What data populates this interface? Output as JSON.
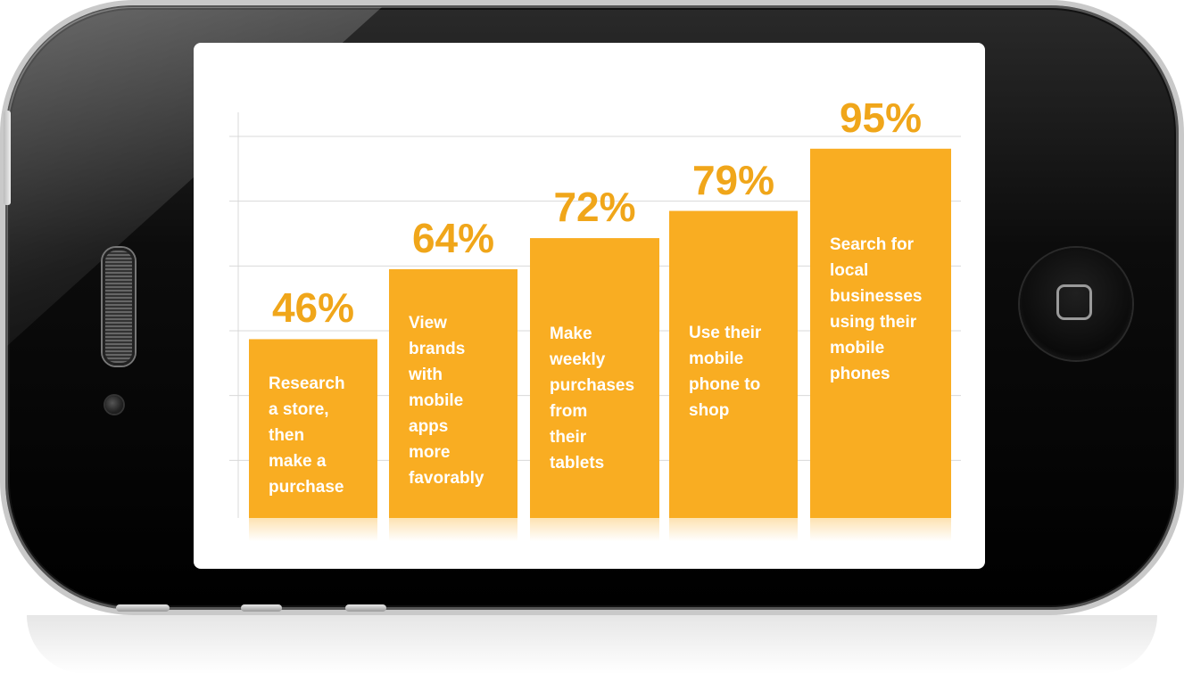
{
  "colors": {
    "bar": "#f9ad22",
    "value_text": "#f0a61a",
    "bar_text": "#ffffff",
    "grid": "#d9d9d9"
  },
  "chart_data": {
    "type": "bar",
    "title": "",
    "xlabel": "",
    "ylabel": "",
    "ylim": [
      0,
      100
    ],
    "grid": true,
    "categories": [
      "Research a store, then make a purchase",
      "View brands with mobile apps more favorably",
      "Make weekly purchases from their tablets",
      "Use their mobile phone to shop",
      "Search for local businesses using their mobile phones"
    ],
    "values": [
      46,
      64,
      72,
      79,
      95
    ],
    "bars": [
      {
        "value_label": "46%",
        "lines": [
          "Research",
          "a store,",
          "then",
          "make a",
          "purchase"
        ]
      },
      {
        "value_label": "64%",
        "lines": [
          "View",
          "brands",
          "with",
          "mobile",
          "apps",
          "more",
          "favorably"
        ]
      },
      {
        "value_label": "72%",
        "lines": [
          "Make",
          "weekly",
          "purchases",
          "from",
          "their",
          "tablets"
        ]
      },
      {
        "value_label": "79%",
        "lines": [
          "Use their",
          "mobile",
          "phone to",
          "shop"
        ]
      },
      {
        "value_label": "95%",
        "lines": [
          "Search for",
          "local",
          "businesses",
          "using their",
          "mobile",
          "phones"
        ]
      }
    ]
  }
}
